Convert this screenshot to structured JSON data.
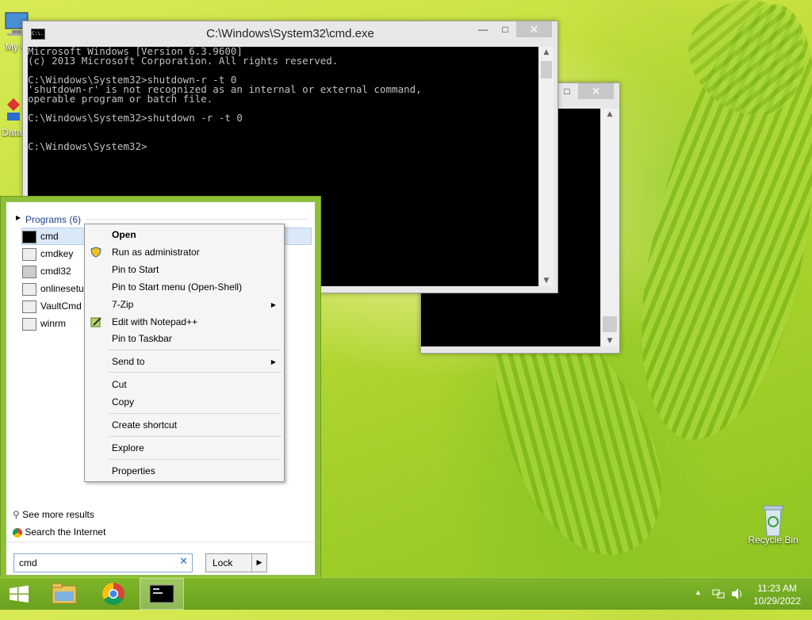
{
  "desktop": {
    "icons": [
      {
        "label": "My C"
      },
      {
        "label": "Data"
      },
      {
        "label": "Recycle Bin"
      }
    ]
  },
  "cmd_window": {
    "title": "C:\\Windows\\System32\\cmd.exe",
    "icon_text": "C:\\.",
    "console_lines": [
      "Microsoft Windows [Version 6.3.9600]",
      "(c) 2013 Microsoft Corporation. All rights reserved.",
      "",
      "C:\\Windows\\System32>shutdown-r -t 0",
      "'shutdown-r' is not recognized as an internal or external command,",
      "operable program or batch file.",
      "",
      "C:\\Windows\\System32>shutdown -r -t 0",
      "",
      "",
      "C:\\Windows\\System32>"
    ],
    "controls": {
      "minimize": "—",
      "maximize": "□",
      "close": "✕"
    }
  },
  "background_window": {
    "controls": {
      "maximize": "□",
      "close": "✕"
    }
  },
  "start_menu": {
    "programs_header": "Programs (6)",
    "programs": [
      {
        "label": "cmd",
        "selected": true
      },
      {
        "label": "cmdkey"
      },
      {
        "label": "cmdl32"
      },
      {
        "label": "onlinesetup"
      },
      {
        "label": "VaultCmd"
      },
      {
        "label": "winrm"
      }
    ],
    "see_more": "See more results",
    "search_internet": "Search the Internet",
    "search_value": "cmd",
    "search_clear": "✕",
    "lock_label": "Lock",
    "lock_arrow": "▶"
  },
  "context_menu": {
    "items": [
      {
        "label": "Open",
        "bold": true
      },
      {
        "label": "Run as administrator"
      },
      {
        "label": "Pin to Start"
      },
      {
        "label": "Pin to Start menu (Open-Shell)"
      },
      {
        "label": "7-Zip",
        "submenu": true
      },
      {
        "label": "Edit with Notepad++"
      },
      {
        "label": "Pin to Taskbar"
      },
      {
        "label": "Send to",
        "submenu": true
      },
      {
        "label": "Cut"
      },
      {
        "label": "Copy"
      },
      {
        "label": "Create shortcut"
      },
      {
        "label": "Explore"
      },
      {
        "label": "Properties"
      }
    ],
    "submenu_arrow": "▶"
  },
  "taskbar": {
    "pinned": [
      "start-button",
      "file-explorer",
      "chrome",
      "cmd"
    ],
    "time": "11:23 AM",
    "date": "10/29/2022",
    "tray_arrow": "▲"
  },
  "colors": {
    "accent": "#8ebf35",
    "taskbar": "#6aa11e",
    "selection": "#dbe8f7",
    "header_text": "#1e3f8a"
  }
}
